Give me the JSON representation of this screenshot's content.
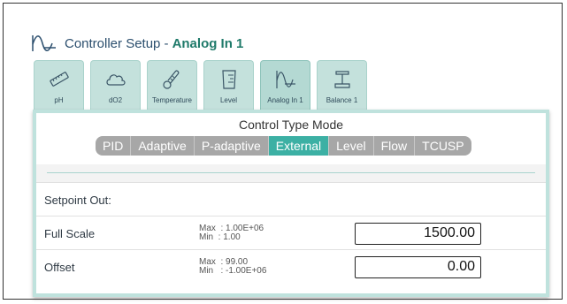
{
  "header": {
    "title_prefix": "Controller Setup -",
    "title_name": "Analog In 1",
    "icon": "analog-wave-icon"
  },
  "tabs": [
    {
      "label": "pH",
      "icon": "ph-probe-icon"
    },
    {
      "label": "dO2",
      "icon": "cloud-icon"
    },
    {
      "label": "Temperature",
      "icon": "thermometer-icon"
    },
    {
      "label": "Level",
      "icon": "beaker-icon"
    },
    {
      "label": "Analog In 1",
      "icon": "analog-wave-icon",
      "active": true
    },
    {
      "label": "Balance 1",
      "icon": "scale-icon"
    }
  ],
  "control_mode": {
    "title": "Control Type Mode",
    "options": [
      "PID",
      "Adaptive",
      "P-adaptive",
      "External",
      "Level",
      "Flow",
      "TCUSP"
    ],
    "selected": "External"
  },
  "setpoint": {
    "label": "Setpoint Out:"
  },
  "fields": {
    "full_scale": {
      "label": "Full Scale",
      "max": "Max  : 1.00E+06",
      "min": "Min  : 1.00",
      "value": "1500.00"
    },
    "offset": {
      "label": "Offset",
      "max": "Max  : 99.00",
      "min": "Min   : -1.00E+06",
      "value": "0.00"
    }
  },
  "colors": {
    "accent": "#3cb0a4",
    "title_name": "#1f7a6a",
    "tab_bg": "#c4e1dc",
    "panel_border": "#bfe2dd",
    "segment_bg": "#a7a7a7"
  }
}
